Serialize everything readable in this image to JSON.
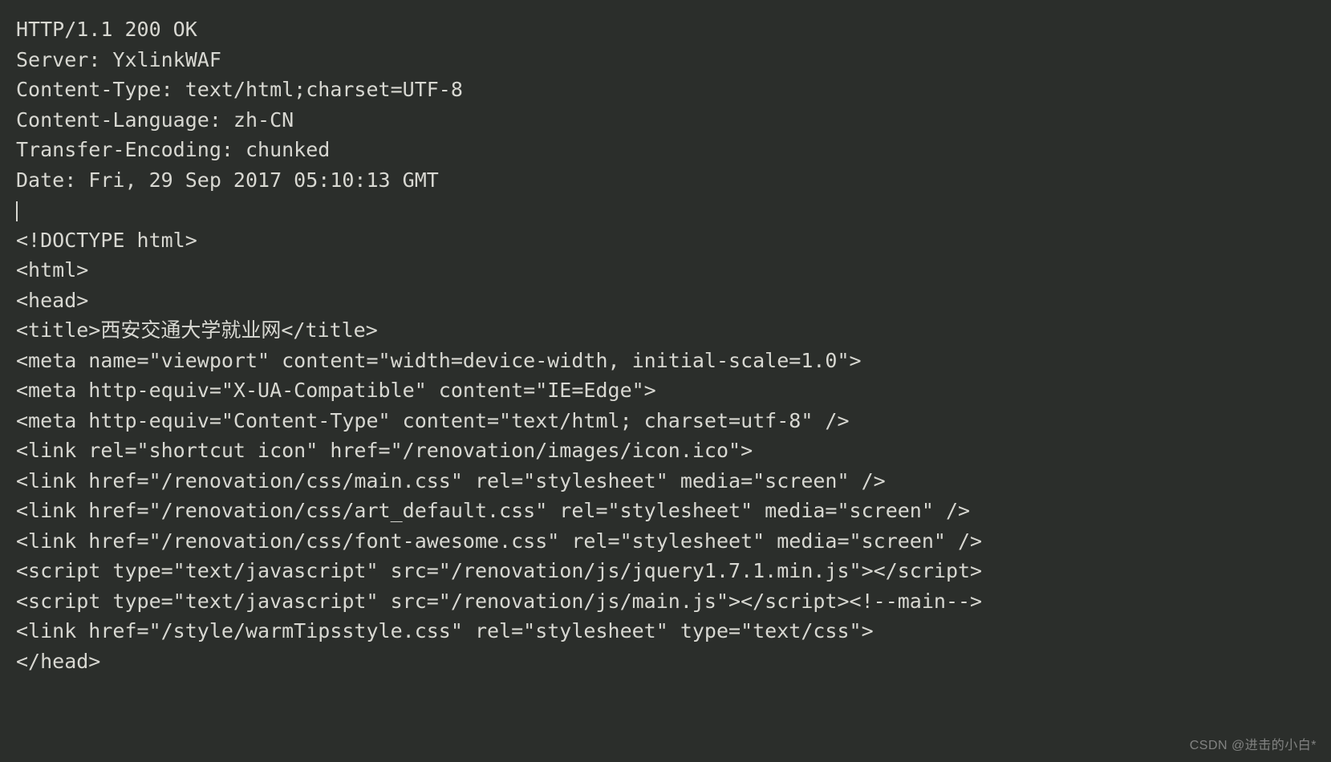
{
  "lines": {
    "l0": "HTTP/1.1 200 OK",
    "l1": "Server: YxlinkWAF",
    "l2": "Content-Type: text/html;charset=UTF-8",
    "l3": "Content-Language: zh-CN",
    "l4": "Transfer-Encoding: chunked",
    "l5": "Date: Fri, 29 Sep 2017 05:10:13 GMT",
    "l6": "",
    "l7": "<!DOCTYPE html>",
    "l8": "<html>",
    "l9": "<head>",
    "l10": "<title>西安交通大学就业网</title>",
    "l11": "<meta name=\"viewport\" content=\"width=device-width, initial-scale=1.0\">",
    "l12": "<meta http-equiv=\"X-UA-Compatible\" content=\"IE=Edge\">",
    "l13": "<meta http-equiv=\"Content-Type\" content=\"text/html; charset=utf-8\" />",
    "l14": "<link rel=\"shortcut icon\" href=\"/renovation/images/icon.ico\">",
    "l15": "<link href=\"/renovation/css/main.css\" rel=\"stylesheet\" media=\"screen\" />",
    "l16": "<link href=\"/renovation/css/art_default.css\" rel=\"stylesheet\" media=\"screen\" />",
    "l17": "<link href=\"/renovation/css/font-awesome.css\" rel=\"stylesheet\" media=\"screen\" />",
    "l18": "<script type=\"text/javascript\" src=\"/renovation/js/jquery1.7.1.min.js\"></script>",
    "l19": "<script type=\"text/javascript\" src=\"/renovation/js/main.js\"></script><!--main-->",
    "l20": "<link href=\"/style/warmTipsstyle.css\" rel=\"stylesheet\" type=\"text/css\">",
    "l21": "</head>"
  },
  "watermark": "CSDN @进击的小白*"
}
